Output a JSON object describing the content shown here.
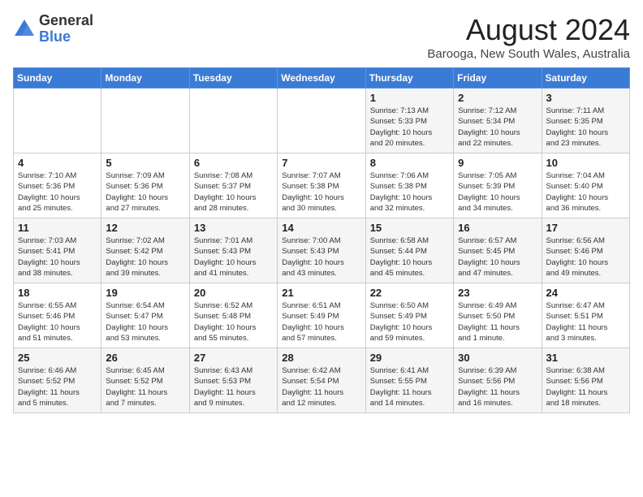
{
  "header": {
    "logo_general": "General",
    "logo_blue": "Blue",
    "month_year": "August 2024",
    "location": "Barooga, New South Wales, Australia"
  },
  "weekdays": [
    "Sunday",
    "Monday",
    "Tuesday",
    "Wednesday",
    "Thursday",
    "Friday",
    "Saturday"
  ],
  "weeks": [
    [
      {
        "day": "",
        "info": ""
      },
      {
        "day": "",
        "info": ""
      },
      {
        "day": "",
        "info": ""
      },
      {
        "day": "",
        "info": ""
      },
      {
        "day": "1",
        "info": "Sunrise: 7:13 AM\nSunset: 5:33 PM\nDaylight: 10 hours\nand 20 minutes."
      },
      {
        "day": "2",
        "info": "Sunrise: 7:12 AM\nSunset: 5:34 PM\nDaylight: 10 hours\nand 22 minutes."
      },
      {
        "day": "3",
        "info": "Sunrise: 7:11 AM\nSunset: 5:35 PM\nDaylight: 10 hours\nand 23 minutes."
      }
    ],
    [
      {
        "day": "4",
        "info": "Sunrise: 7:10 AM\nSunset: 5:36 PM\nDaylight: 10 hours\nand 25 minutes."
      },
      {
        "day": "5",
        "info": "Sunrise: 7:09 AM\nSunset: 5:36 PM\nDaylight: 10 hours\nand 27 minutes."
      },
      {
        "day": "6",
        "info": "Sunrise: 7:08 AM\nSunset: 5:37 PM\nDaylight: 10 hours\nand 28 minutes."
      },
      {
        "day": "7",
        "info": "Sunrise: 7:07 AM\nSunset: 5:38 PM\nDaylight: 10 hours\nand 30 minutes."
      },
      {
        "day": "8",
        "info": "Sunrise: 7:06 AM\nSunset: 5:38 PM\nDaylight: 10 hours\nand 32 minutes."
      },
      {
        "day": "9",
        "info": "Sunrise: 7:05 AM\nSunset: 5:39 PM\nDaylight: 10 hours\nand 34 minutes."
      },
      {
        "day": "10",
        "info": "Sunrise: 7:04 AM\nSunset: 5:40 PM\nDaylight: 10 hours\nand 36 minutes."
      }
    ],
    [
      {
        "day": "11",
        "info": "Sunrise: 7:03 AM\nSunset: 5:41 PM\nDaylight: 10 hours\nand 38 minutes."
      },
      {
        "day": "12",
        "info": "Sunrise: 7:02 AM\nSunset: 5:42 PM\nDaylight: 10 hours\nand 39 minutes."
      },
      {
        "day": "13",
        "info": "Sunrise: 7:01 AM\nSunset: 5:43 PM\nDaylight: 10 hours\nand 41 minutes."
      },
      {
        "day": "14",
        "info": "Sunrise: 7:00 AM\nSunset: 5:43 PM\nDaylight: 10 hours\nand 43 minutes."
      },
      {
        "day": "15",
        "info": "Sunrise: 6:58 AM\nSunset: 5:44 PM\nDaylight: 10 hours\nand 45 minutes."
      },
      {
        "day": "16",
        "info": "Sunrise: 6:57 AM\nSunset: 5:45 PM\nDaylight: 10 hours\nand 47 minutes."
      },
      {
        "day": "17",
        "info": "Sunrise: 6:56 AM\nSunset: 5:46 PM\nDaylight: 10 hours\nand 49 minutes."
      }
    ],
    [
      {
        "day": "18",
        "info": "Sunrise: 6:55 AM\nSunset: 5:46 PM\nDaylight: 10 hours\nand 51 minutes."
      },
      {
        "day": "19",
        "info": "Sunrise: 6:54 AM\nSunset: 5:47 PM\nDaylight: 10 hours\nand 53 minutes."
      },
      {
        "day": "20",
        "info": "Sunrise: 6:52 AM\nSunset: 5:48 PM\nDaylight: 10 hours\nand 55 minutes."
      },
      {
        "day": "21",
        "info": "Sunrise: 6:51 AM\nSunset: 5:49 PM\nDaylight: 10 hours\nand 57 minutes."
      },
      {
        "day": "22",
        "info": "Sunrise: 6:50 AM\nSunset: 5:49 PM\nDaylight: 10 hours\nand 59 minutes."
      },
      {
        "day": "23",
        "info": "Sunrise: 6:49 AM\nSunset: 5:50 PM\nDaylight: 11 hours\nand 1 minute."
      },
      {
        "day": "24",
        "info": "Sunrise: 6:47 AM\nSunset: 5:51 PM\nDaylight: 11 hours\nand 3 minutes."
      }
    ],
    [
      {
        "day": "25",
        "info": "Sunrise: 6:46 AM\nSunset: 5:52 PM\nDaylight: 11 hours\nand 5 minutes."
      },
      {
        "day": "26",
        "info": "Sunrise: 6:45 AM\nSunset: 5:52 PM\nDaylight: 11 hours\nand 7 minutes."
      },
      {
        "day": "27",
        "info": "Sunrise: 6:43 AM\nSunset: 5:53 PM\nDaylight: 11 hours\nand 9 minutes."
      },
      {
        "day": "28",
        "info": "Sunrise: 6:42 AM\nSunset: 5:54 PM\nDaylight: 11 hours\nand 12 minutes."
      },
      {
        "day": "29",
        "info": "Sunrise: 6:41 AM\nSunset: 5:55 PM\nDaylight: 11 hours\nand 14 minutes."
      },
      {
        "day": "30",
        "info": "Sunrise: 6:39 AM\nSunset: 5:56 PM\nDaylight: 11 hours\nand 16 minutes."
      },
      {
        "day": "31",
        "info": "Sunrise: 6:38 AM\nSunset: 5:56 PM\nDaylight: 11 hours\nand 18 minutes."
      }
    ]
  ]
}
